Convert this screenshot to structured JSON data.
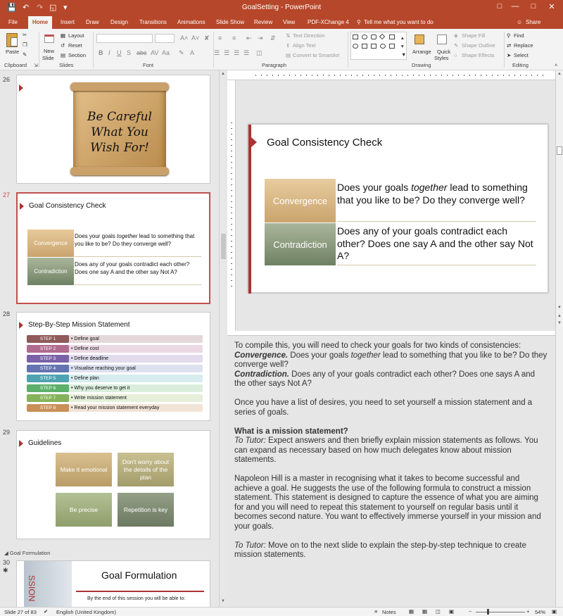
{
  "window": {
    "title": "GoalSetting - PowerPoint"
  },
  "tabs": [
    "File",
    "Home",
    "Insert",
    "Draw",
    "Design",
    "Transitions",
    "Animations",
    "Slide Show",
    "Review",
    "View",
    "PDF-XChange 4"
  ],
  "tell_me": "Tell me what you want to do",
  "share": "Share",
  "ribbon": {
    "clipboard": {
      "label": "Clipboard",
      "paste": "Paste"
    },
    "slides": {
      "label": "Slides",
      "new_slide": "New",
      "new_slide2": "Slide",
      "layout": "Layout",
      "reset": "Reset",
      "section": "Section"
    },
    "font": {
      "label": "Font"
    },
    "paragraph": {
      "label": "Paragraph",
      "text_direction": "Text Direction",
      "align_text": "Align Text",
      "smartart": "Convert to SmartArt"
    },
    "drawing": {
      "label": "Drawing",
      "arrange": "Arrange",
      "quick_styles": "Quick",
      "quick_styles2": "Styles",
      "shape_fill": "Shape Fill",
      "shape_outline": "Shape Outline",
      "shape_effects": "Shape Effects"
    },
    "editing": {
      "label": "Editing",
      "find": "Find",
      "replace": "Replace",
      "select": "Select"
    }
  },
  "thumbnails": {
    "s26": {
      "num": "26",
      "scroll_text": [
        "Be Careful",
        "What You",
        "Wish For!"
      ]
    },
    "s27": {
      "num": "27",
      "title": "Goal Consistency Check"
    },
    "s28": {
      "num": "28",
      "title": "Step-By-Step Mission Statement",
      "steps": [
        {
          "label": "STEP 1",
          "text": "• Define goal",
          "color": "#8e5a5a",
          "bg": "#e5d8d8"
        },
        {
          "label": "STEP 2",
          "text": "• Define cost",
          "color": "#b06b8f",
          "bg": "#ead8e3"
        },
        {
          "label": "STEP 3",
          "text": "• Define deadline",
          "color": "#7b62a8",
          "bg": "#e1dbec"
        },
        {
          "label": "STEP 4",
          "text": "• Visualise reaching your goal",
          "color": "#6474b0",
          "bg": "#dde1ef"
        },
        {
          "label": "STEP 5",
          "text": "• Define plan",
          "color": "#4fa3b0",
          "bg": "#d8ecef"
        },
        {
          "label": "STEP 6",
          "text": "• Why you deserve to get it",
          "color": "#5cb06a",
          "bg": "#dbeedd"
        },
        {
          "label": "STEP 7",
          "text": "• Write mission statement",
          "color": "#86b35a",
          "bg": "#e5efd9"
        },
        {
          "label": "STEP 8",
          "text": "• Read your mission statement everyday",
          "color": "#c9905a",
          "bg": "#f1e4d7"
        }
      ]
    },
    "s29": {
      "num": "29",
      "title": "Guidelines",
      "boxes": [
        "Make it emotional",
        "Don't worry about the details of the plan",
        "Be precise",
        "Repetition is key"
      ]
    },
    "section": "Goal Formulation",
    "s30": {
      "num": "30",
      "title": "Goal Formulation",
      "sub": "By the end of this session you will be able to:",
      "side": "SSION"
    }
  },
  "slide": {
    "title": "Goal Consistency Check",
    "rows": [
      {
        "label": "Convergence",
        "q_a": "Does your goals ",
        "q_em": "together",
        "q_b": " lead to something that you like to be? Do they converge well?"
      },
      {
        "label": "Contradiction",
        "q_a": "Does any of your goals contradict each other? Does one say A and the other say Not A?",
        "q_em": "",
        "q_b": ""
      }
    ]
  },
  "notes": {
    "p1": "To compile this, you will need to check your goals for two kinds of consistencies:",
    "p2_b": "Convergence.",
    "p2_a": " Does your goals ",
    "p2_i": "together",
    "p2_c": " lead to something that you like to be? Do they converge well?",
    "p3_b": "Contradiction.",
    "p3_c": " Does any of your goals contradict each other? Does one says A and the other says Not A?",
    "p4": "Once you have a list of desires, you need to set yourself a mission statement and a series of goals.",
    "p5": "What is a mission statement?",
    "p6_i": "To Tutor:",
    "p6_c": " Expect answers and then briefly explain mission statements as follows. You can expand as necessary based on how much delegates know about mission statements.",
    "p7": "Napoleon Hill is a master in recognising what it takes to become successful and achieve a goal. He suggests the use of the following formula to construct a mission statement. This statement is designed to capture the essence of what you are aiming for and you will need to repeat this statement to yourself on regular basis until it becomes second nature. You want to effectively immerse yourself in your mission and your goals.",
    "p8_i": "To Tutor:",
    "p8_c": " Move on to the next slide to explain the step-by-step technique to create mission statements."
  },
  "status": {
    "slide": "Slide 27 of 83",
    "lang": "English (United Kingdom)",
    "notes": "Notes",
    "zoom": "54%"
  }
}
